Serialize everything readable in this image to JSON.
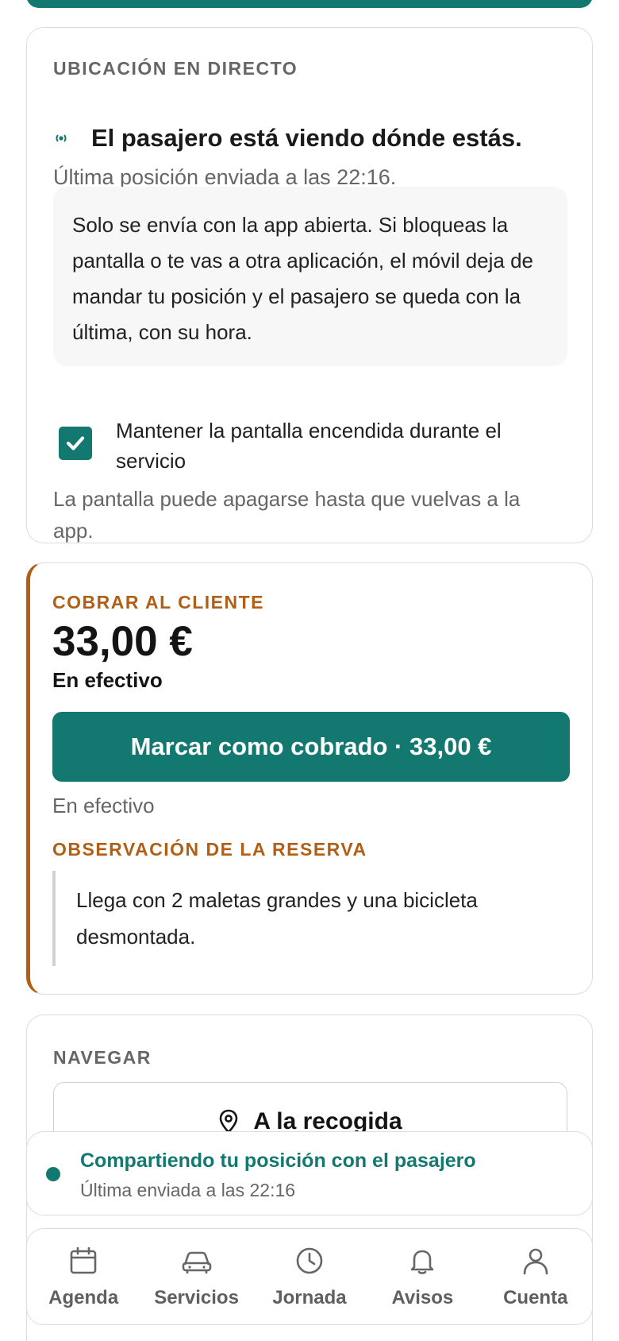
{
  "live": {
    "section_title": "UBICACIÓN EN DIRECTO",
    "headline": "El pasajero está viendo dónde estás.",
    "last_position": "Última posición enviada a las 22:16.",
    "info": "Solo se envía con la app abierta. Si bloqueas la pantalla o te vas a otra aplicación, el móvil deja de mandar tu posición y el pasajero se queda con la última, con su hora.",
    "keep_screen_label": "Mantener la pantalla encendida durante el servicio",
    "keep_screen_checked": true,
    "keep_screen_note": "La pantalla puede apagarse hasta que vuelvas a la app."
  },
  "payment": {
    "section_title": "COBRAR AL CLIENTE",
    "amount": "33,00 €",
    "method": "En efectivo",
    "charge_button": "Marcar como cobrado · 33,00 €",
    "method_sub": "En efectivo",
    "observation_title": "OBSERVACIÓN DE LA RESERVA",
    "observation": "Llega con 2 maletas grandes y una bicicleta desmontada."
  },
  "navigate": {
    "section_title": "NAVEGAR",
    "pickup_button": "A la recogida"
  },
  "toast": {
    "title": "Compartiendo tu posición con el pasajero",
    "subtitle": "Última enviada a las 22:16"
  },
  "bottom_nav": {
    "items": [
      {
        "label": "Agenda",
        "icon": "calendar-icon"
      },
      {
        "label": "Servicios",
        "icon": "car-icon"
      },
      {
        "label": "Jornada",
        "icon": "clock-icon"
      },
      {
        "label": "Avisos",
        "icon": "bell-icon"
      },
      {
        "label": "Cuenta",
        "icon": "user-icon"
      }
    ]
  },
  "colors": {
    "primary": "#13786f",
    "accent": "#b15f15",
    "muted_text": "#666666",
    "border": "#dcdcdc"
  }
}
